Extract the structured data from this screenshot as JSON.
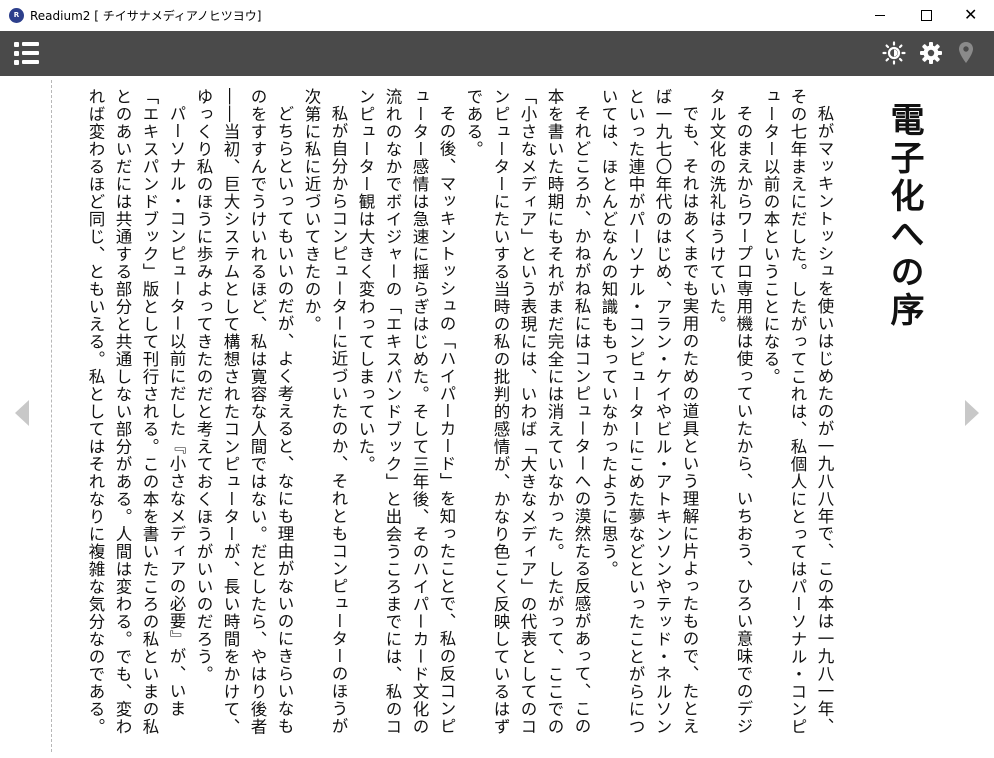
{
  "window": {
    "app_icon_text": "R",
    "title": "Readium2 [ チイサナメディアノヒツヨウ]"
  },
  "toolbar": {
    "toc_icon": "list-icon",
    "brightness_icon": "brightness-icon",
    "settings_icon": "gear-icon",
    "location_icon": "location-pin-icon"
  },
  "colors": {
    "toolbar_bg": "#4a4a4a",
    "text": "#111111",
    "arrow": "#c8c8c8"
  },
  "book": {
    "chapter_title": "電子化への序",
    "paragraphs": [
      "私がマッキントッシュを使いはじめたのが一九八八年で、この本は一九八一年、その七年まえにだした。したがってこれは、私個人にとってはパーソナル・コンピューター以前の本ということになる。",
      "そのまえからワープロ専用機は使っていたから、いちおう、ひろい意味でのデジタル文化の洗礼はうけていた。",
      "でも、それはあくまでも実用のための道具という理解に片よったもので、たとえば一九七〇年代のはじめ、アラン・ケイやビル・アトキンソンやテッド・ネルソンといった連中がパーソナル・コンピューターにこめた夢などといったことがらについては、ほとんどなんの知識ももっていなかったように思う。",
      "それどころか、かねがね私にはコンピューターへの漠然たる反感があって、この本を書いた時期にもそれがまだ完全には消えていなかった。したがって、ここでの「小さなメディア」という表現には、いわば「大きなメディア」の代表としてのコンピューターにたいする当時の私の批判的感情が、かなり色こく反映しているはずである。",
      "その後、マッキントッシュの「ハイパーカード」を知ったことで、私の反コンピューター感情は急速に揺らぎはじめた。そして三年後、そのハイパーカード文化の流れのなかでボイジャーの「エキスパンドブック」と出会うころまでには、私のコンピューター観は大きく変わってしまっていた。",
      "私が自分からコンピューターに近づいたのか、それともコンピューターのほうが次第に私に近づいてきたのか。",
      "どちらといってもいいのだが、よく考えると、なにも理由がないのにきらいなものをすすんでうけいれるほど、私は寛容な人間ではない。だとしたら、やはり後者――当初、巨大システムとして構想されたコンピューターが、長い時間をかけて、ゆっくり私のほうに歩みよってきたのだと考えておくほうがいいのだろう。",
      "パーソナル・コンピューター以前にだした『小さなメディアの必要』が、いま「エキスパンドブック」版として刊行される。この本を書いたころの私といまの私とのあいだには共通する部分と共通しない部分がある。人間は変わる。でも、変われば変わるほど同じ、ともいえる。私としてはそれなりに複雑な気分なのである。"
    ]
  }
}
